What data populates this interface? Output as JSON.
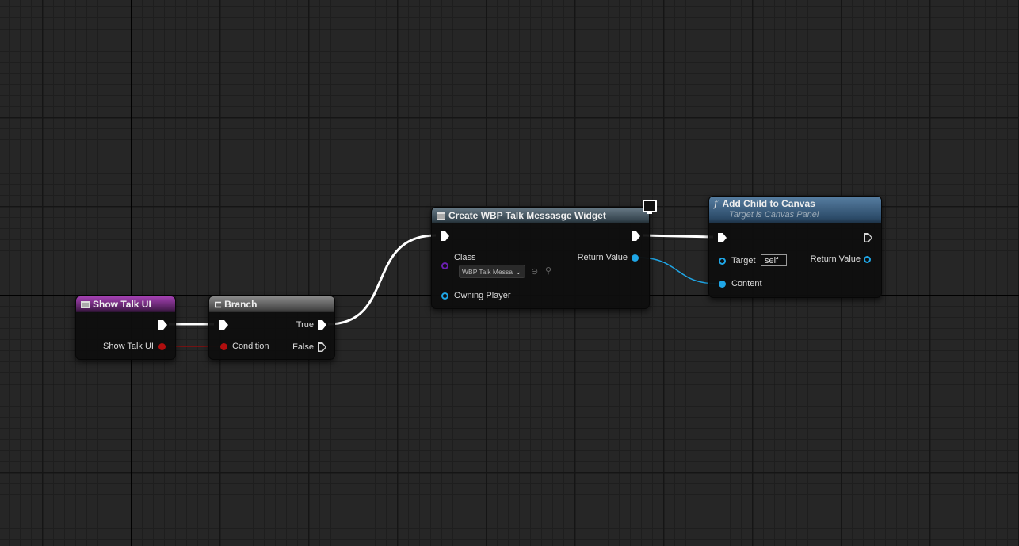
{
  "graph": {
    "colors": {
      "exec_wire": "#ffffff",
      "bool_wire": "#8b0d0d",
      "object_wire": "#1fa6e6",
      "background": "#262626"
    }
  },
  "nodes": {
    "show_talk_event": {
      "title": "Show Talk UI",
      "output_pin": "Show Talk UI"
    },
    "branch": {
      "title": "Branch",
      "condition_pin": "Condition",
      "true_pin": "True",
      "false_pin": "False"
    },
    "create_widget": {
      "title": "Create WBP Talk Messasge Widget",
      "class_pin": "Class",
      "class_value": "WBP Talk Messa",
      "owning_player_pin": "Owning Player",
      "return_value_pin": "Return Value"
    },
    "add_child": {
      "title": "Add Child to Canvas",
      "subtitle": "Target is Canvas Panel",
      "target_pin": "Target",
      "target_value": "self",
      "content_pin": "Content",
      "return_value_pin": "Return Value"
    }
  },
  "icons": [
    "event-icon",
    "branch-icon",
    "widget-icon",
    "function-icon",
    "monitor-icon",
    "use-selected-icon",
    "browse-icon"
  ]
}
